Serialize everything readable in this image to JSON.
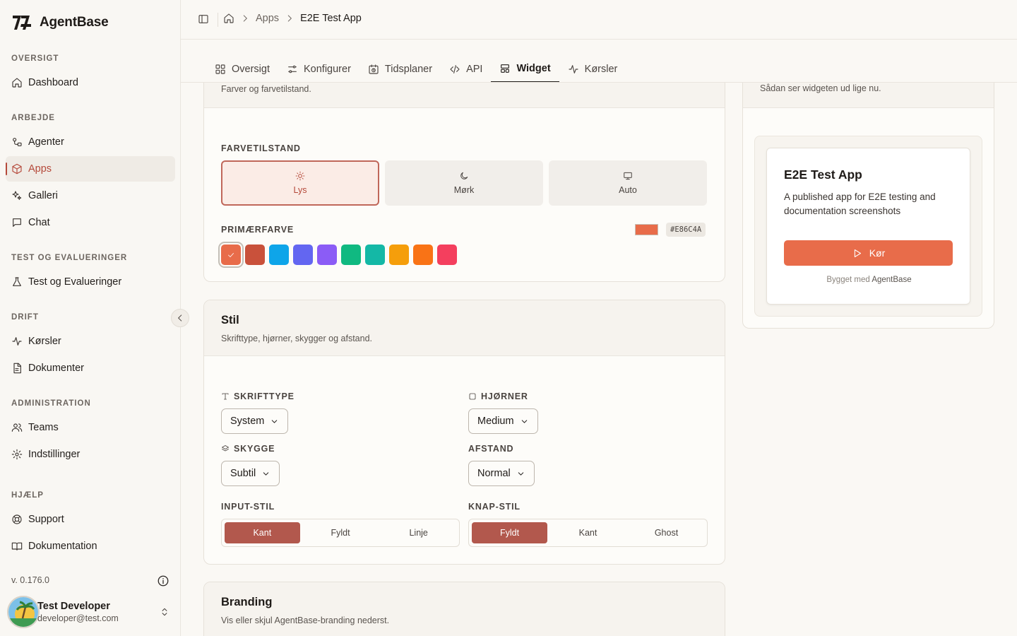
{
  "brand": {
    "name": "AgentBase"
  },
  "sidebar": {
    "sections": [
      {
        "heading": "OVERSIGT",
        "items": [
          {
            "label": "Dashboard",
            "icon": "home-icon"
          }
        ]
      },
      {
        "heading": "ARBEJDE",
        "items": [
          {
            "label": "Agenter",
            "icon": "agents-icon"
          },
          {
            "label": "Apps",
            "icon": "box-icon",
            "active": true
          },
          {
            "label": "Galleri",
            "icon": "sparkles-icon"
          },
          {
            "label": "Chat",
            "icon": "chat-icon"
          }
        ]
      },
      {
        "heading": "TEST OG EVALUERINGER",
        "items": [
          {
            "label": "Test og Evalueringer",
            "icon": "flask-icon"
          }
        ]
      },
      {
        "heading": "DRIFT",
        "items": [
          {
            "label": "Kørsler",
            "icon": "activity-icon"
          },
          {
            "label": "Dokumenter",
            "icon": "document-icon"
          }
        ]
      },
      {
        "heading": "ADMINISTRATION",
        "items": [
          {
            "label": "Teams",
            "icon": "users-icon"
          },
          {
            "label": "Indstillinger",
            "icon": "gear-icon"
          }
        ]
      },
      {
        "heading": "HJÆLP",
        "items": [
          {
            "label": "Support",
            "icon": "lifebuoy-icon"
          },
          {
            "label": "Dokumentation",
            "icon": "book-icon"
          }
        ]
      }
    ],
    "version": "v. 0.176.0",
    "user": {
      "name": "Test Developer",
      "email": "developer@test.com"
    }
  },
  "breadcrumb": {
    "parent": "Apps",
    "current": "E2E Test App"
  },
  "tabs": [
    {
      "label": "Oversigt",
      "icon": "grid-icon"
    },
    {
      "label": "Konfigurer",
      "icon": "sliders-icon"
    },
    {
      "label": "Tidsplaner",
      "icon": "calendar-clock-icon"
    },
    {
      "label": "API",
      "icon": "code-icon"
    },
    {
      "label": "Widget",
      "icon": "layout-icon",
      "active": true
    },
    {
      "label": "Kørsler",
      "icon": "activity-icon"
    }
  ],
  "colors_card": {
    "subtitle": "Farver og farvetilstand.",
    "mode_label": "FARVETILSTAND",
    "modes": {
      "light": "Lys",
      "dark": "Mørk",
      "auto": "Auto"
    },
    "selected_mode": "Lys",
    "primary_label": "PRIMÆRFARVE",
    "primary_hex": "#E86C4A",
    "swatches": [
      "#e86c4a",
      "#c9513b",
      "#0ea5e9",
      "#6366f1",
      "#8b5cf6",
      "#10b981",
      "#14b8a6",
      "#f59e0b",
      "#f97316",
      "#f43f5e"
    ]
  },
  "style_card": {
    "title": "Stil",
    "subtitle": "Skrifttype, hjørner, skygger og afstand.",
    "font_label": "SKRIFTTYPE",
    "font_value": "System",
    "corners_label": "HJØRNER",
    "corners_value": "Medium",
    "shadow_label": "SKYGGE",
    "shadow_value": "Subtil",
    "spacing_label": "AFSTAND",
    "spacing_value": "Normal",
    "input_style_label": "INPUT-STIL",
    "input_style_options": [
      "Kant",
      "Fyldt",
      "Linje"
    ],
    "input_style_selected": "Kant",
    "button_style_label": "KNAP-STIL",
    "button_style_options": [
      "Fyldt",
      "Kant",
      "Ghost"
    ],
    "button_style_selected": "Fyldt"
  },
  "branding_card": {
    "title": "Branding",
    "subtitle": "Vis eller skjul AgentBase-branding nederst."
  },
  "preview": {
    "subtitle": "Sådan ser widgeten ud lige nu.",
    "app_title": "E2E Test App",
    "app_description": "A published app for E2E testing and documentation screenshots",
    "run_label": "Kør",
    "footer_prefix": "Bygget med",
    "footer_brand": "AgentBase"
  },
  "accent_color": "#e86c4a",
  "active_color": "#b5493a"
}
